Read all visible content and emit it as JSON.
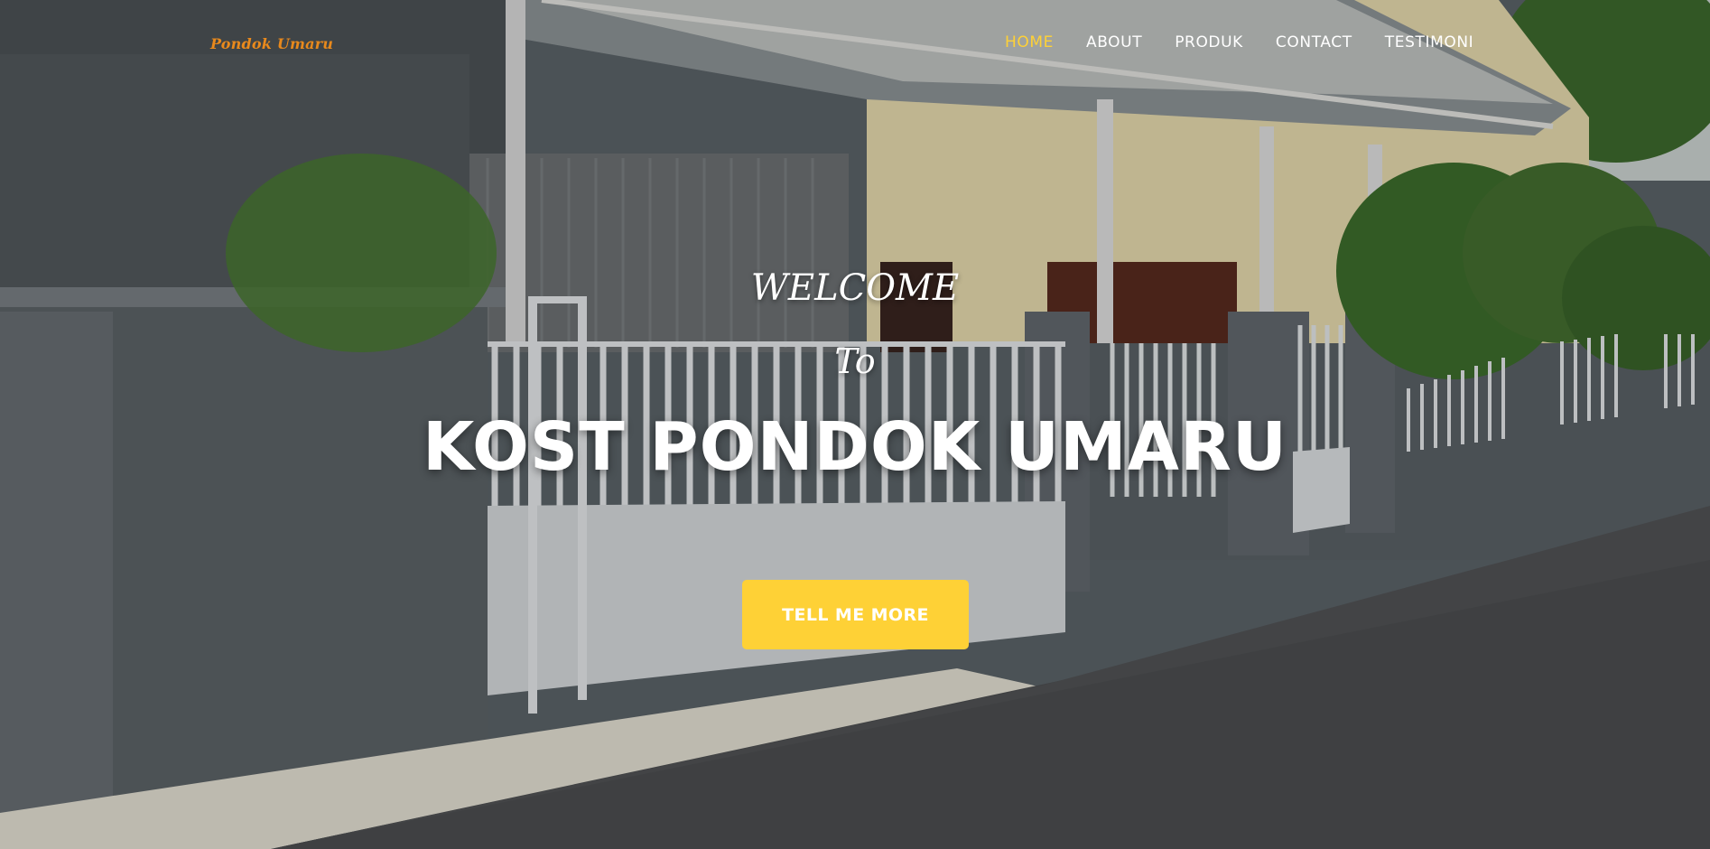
{
  "brand": {
    "name": "Pondok Umaru"
  },
  "nav": {
    "items": [
      {
        "label": "HOME",
        "active": true
      },
      {
        "label": "ABOUT",
        "active": false
      },
      {
        "label": "PRODUK",
        "active": false
      },
      {
        "label": "CONTACT",
        "active": false
      },
      {
        "label": "TESTIMONI",
        "active": false
      }
    ]
  },
  "hero": {
    "welcome": "WELCOME",
    "to": "To",
    "headline": "KOST PONDOK UMARU",
    "cta_label": "TELL ME MORE"
  },
  "colors": {
    "accent": "#fed136",
    "brand": "#e8891c",
    "text": "#ffffff"
  }
}
